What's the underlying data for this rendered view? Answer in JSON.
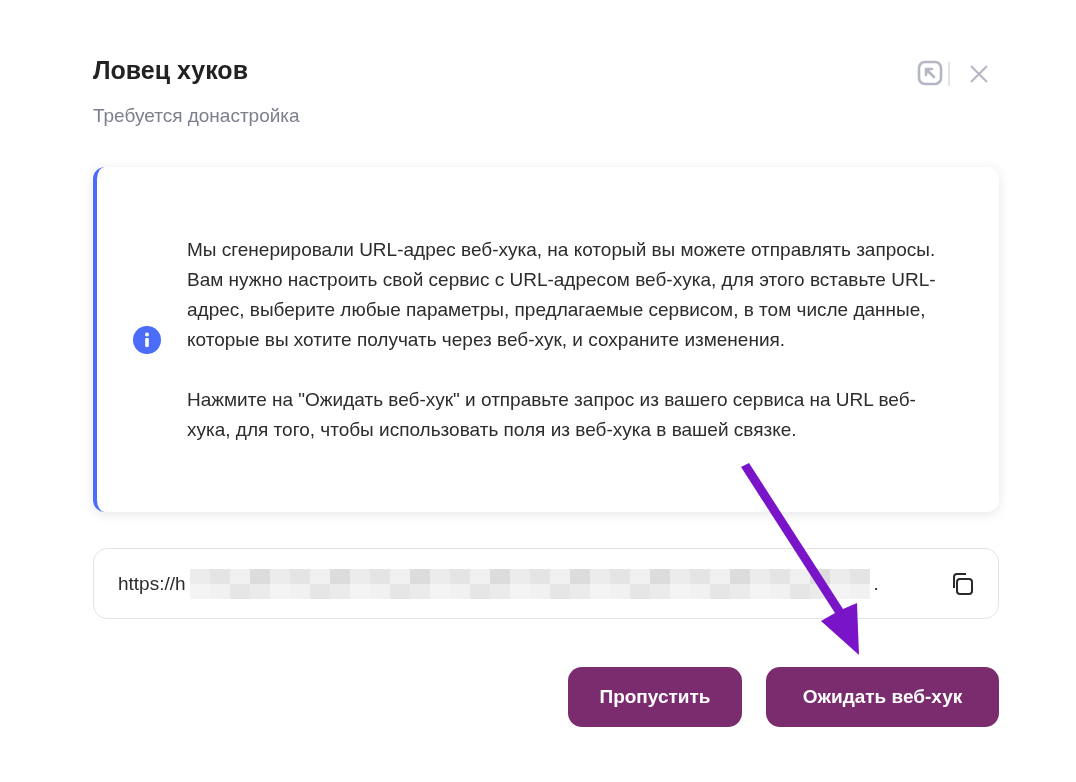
{
  "dialog": {
    "title": "Ловец хуков",
    "subtitle": "Требуется донастройка"
  },
  "info": {
    "paragraphs": [
      "Мы сгенерировали URL-адрес веб-хука, на который вы можете отправлять запросы. Вам нужно настроить свой сервис с URL-адресом веб-хука, для этого вставьте URL-адрес, выберите любые параметры, предлагаемые сервисом, в том числе данные, которые вы хотите получать через веб-хук, и сохраните изменения.",
      "Нажмите на \"Ожидать веб-хук\" и отправьте запрос из вашего сервиса на URL веб-хука, для того, чтобы использовать поля из веб-хука в вашей связке."
    ]
  },
  "url_field": {
    "value_start": "https://h",
    "value_end": "."
  },
  "buttons": [
    {
      "label": "Пропустить"
    },
    {
      "label": "Ожидать веб-хук"
    }
  ]
}
